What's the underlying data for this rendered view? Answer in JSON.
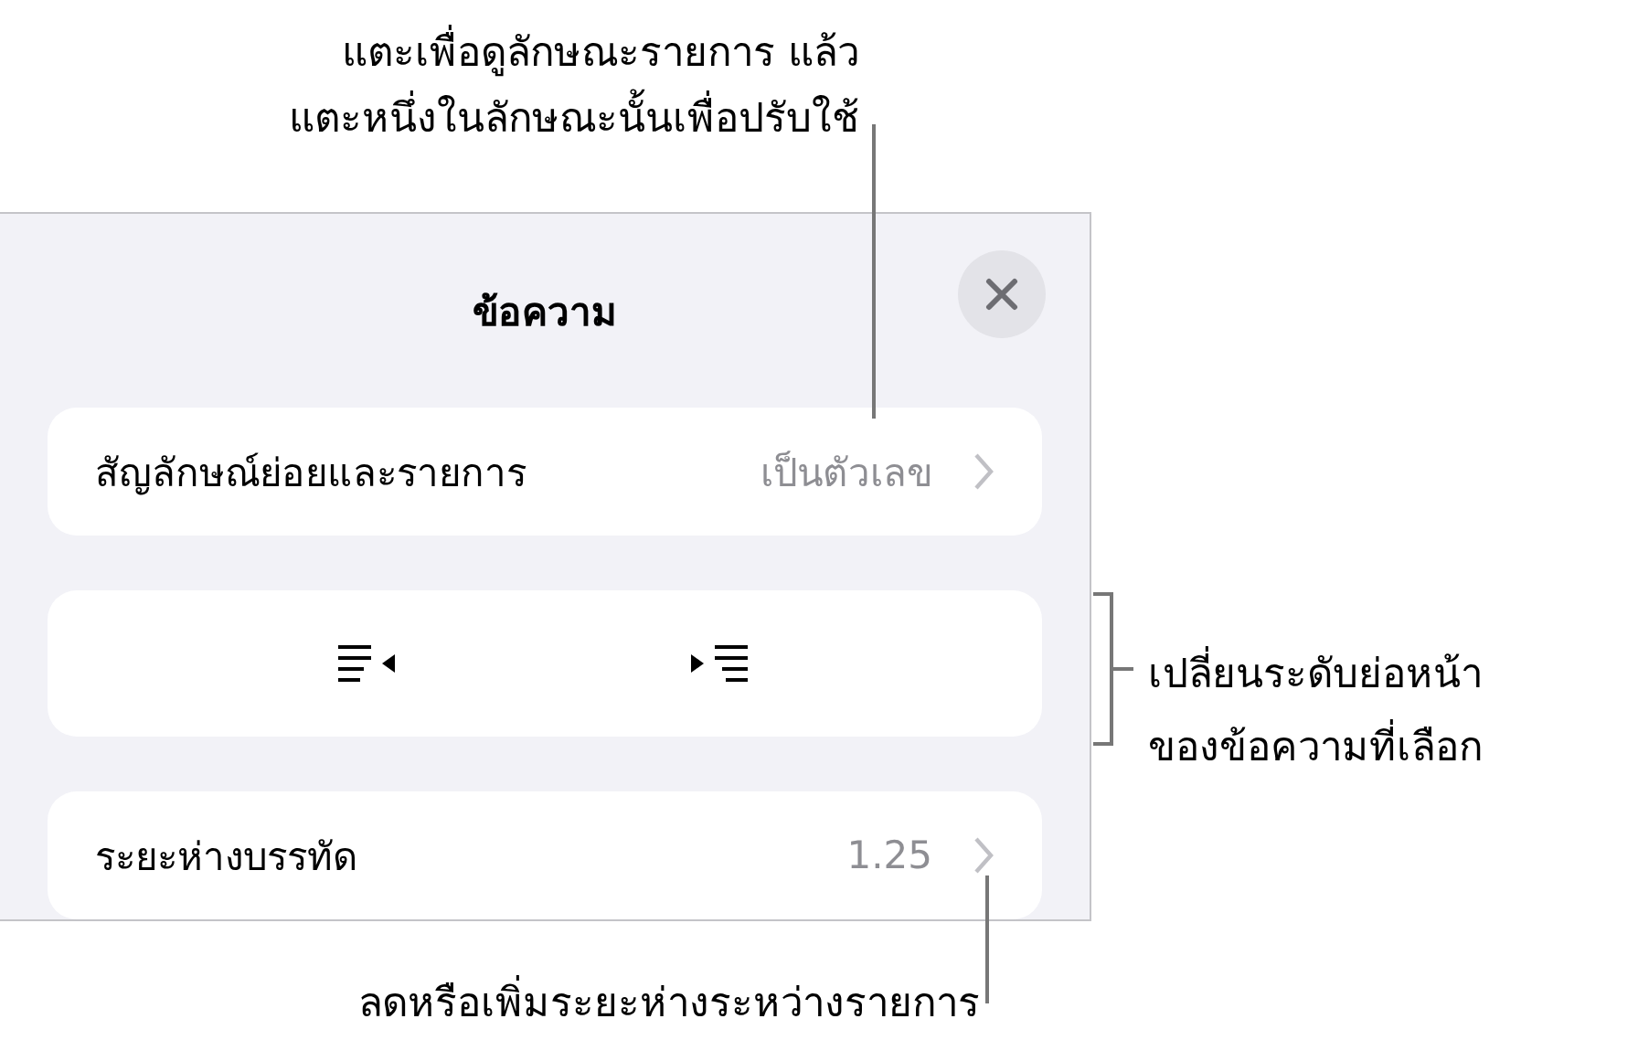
{
  "panel": {
    "title": "ข้อความ",
    "rows": [
      {
        "kind": "disclosure",
        "label": "สัญลักษณ์ย่อยและรายการ",
        "value": "เป็นตัวเลข"
      },
      {
        "kind": "indent-buttons"
      },
      {
        "kind": "disclosure",
        "label": "ระยะห่างบรรทัด",
        "value": "1.25"
      }
    ]
  },
  "callouts": [
    {
      "kind": "top",
      "lines": [
        "แตะเพื่อดูลักษณะรายการ แล้ว",
        "แตะหนึ่งในลักษณะนั้นเพื่อปรับใช้"
      ]
    },
    {
      "kind": "bracket",
      "lines": [
        "เปลี่ยนระดับย่อหน้า",
        "ของข้อความที่เลือก"
      ]
    },
    {
      "kind": "bottom",
      "lines": [
        "ลดหรือเพิ่มระยะห่างระหว่างรายการ"
      ]
    }
  ]
}
